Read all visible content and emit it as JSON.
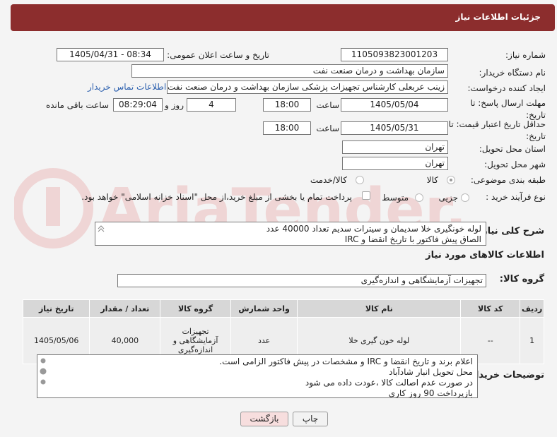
{
  "header": {
    "title": "جزئیات اطلاعات نیاز"
  },
  "need_number": {
    "label": "شماره نیاز:",
    "value": "1105093823001203"
  },
  "announce": {
    "label": "تاریخ و ساعت اعلان عمومی:",
    "value": "1405/04/31 - 08:34"
  },
  "buyer_org": {
    "label": "نام دستگاه خریدار:",
    "value": "سازمان بهداشت و درمان صنعت نفت"
  },
  "requester": {
    "label": "ایجاد کننده درخواست:",
    "value": "زینب عربعلی کارشناس تجهیزات پزشکی سازمان بهداشت و درمان صنعت نفت",
    "contact_link": "اطلاعات تماس خریدار"
  },
  "send_deadline": {
    "label": "مهلت ارسال پاسخ: تا تاریخ:",
    "date": "1405/05/04",
    "time_label": "ساعت",
    "time": "18:00",
    "days": "4",
    "days_label": "روز و",
    "remaining": "08:29:04",
    "remaining_label": "ساعت باقی مانده"
  },
  "price_deadline": {
    "label": "حداقل تاریخ اعتبار قیمت: تا تاریخ:",
    "date": "1405/05/31",
    "time_label": "ساعت",
    "time": "18:00"
  },
  "province": {
    "label": "استان محل تحویل:",
    "value": "تهران"
  },
  "city": {
    "label": "شهر محل تحویل:",
    "value": "تهران"
  },
  "category": {
    "label": "طبقه بندی موضوعی:",
    "options": [
      "کالا",
      "کالا/خدمت"
    ],
    "selected": "کالا"
  },
  "process": {
    "label": "نوع فرآیند خرید :",
    "options": [
      "جزیی",
      "متوسط"
    ],
    "note": "پرداخت تمام یا بخشی از مبلغ خرید،از محل \"اسناد خزانه اسلامی\" خواهد بود."
  },
  "description": {
    "label": "شرح کلی نیاز:",
    "lines": [
      "لوله خونگیری خلا سدیمان و سیترات سدیم تعداد 40000 عدد",
      "الصاق پیش فاکتور با تاریخ انقضا و IRC"
    ]
  },
  "goods_section": {
    "title": "اطلاعات کالاهای مورد نیاز"
  },
  "goods_group": {
    "label": "گروه کالا:",
    "value": "تجهیزات آزمایشگاهی و اندازه‌گیری"
  },
  "table": {
    "headers": [
      "ردیف",
      "کد کالا",
      "نام کالا",
      "واحد شمارش",
      "گروه کالا",
      "تعداد / مقدار",
      "تاریخ نیاز"
    ],
    "rows": [
      [
        "1",
        "--",
        "لوله خون گیری خلا",
        "عدد",
        "تجهیزات آزمایشگاهی و اندازه‌گیری",
        "40,000",
        "1405/05/06"
      ]
    ]
  },
  "buyer_notes": {
    "label": "توضیحات خریدار:",
    "lines": [
      "اعلام برند و تاریخ انقضا  و IRC  و مشخصات  در پیش فاکتور الزامی است.",
      "محل تحویل انبار شادآباد",
      "در صورت عدم اصالت کالا ،عودت داده می شود",
      "بازپرداخت 90 روز کاری"
    ]
  },
  "buttons": {
    "print": "چاپ",
    "back": "بازگشت"
  },
  "watermark": {
    "text": "AriaTender.net"
  },
  "colors": {
    "header": "#8c2d2d",
    "link": "#2b5fae",
    "back_button": "#f7dede"
  }
}
